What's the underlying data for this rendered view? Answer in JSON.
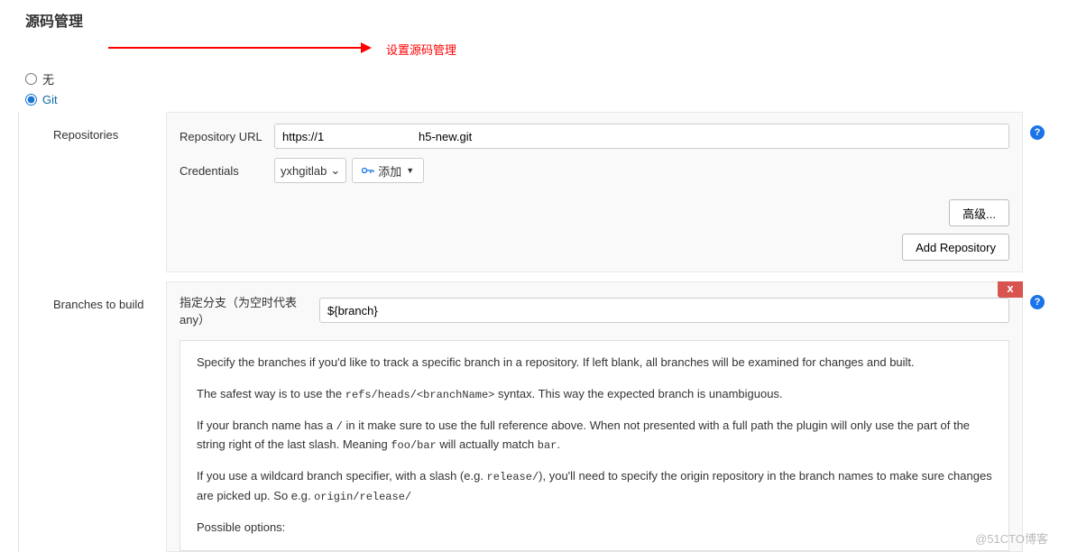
{
  "section_title": "源码管理",
  "annotation": "设置源码管理",
  "scm_options": {
    "none": "无",
    "git": "Git"
  },
  "repositories": {
    "label": "Repositories",
    "url_label": "Repository URL",
    "url_value": "https://1                             h5-new.git",
    "cred_label": "Credentials",
    "cred_value": "yxhgitlab",
    "add_label": "添加",
    "advanced_btn": "高级...",
    "add_repo_btn": "Add Repository"
  },
  "branches": {
    "label": "Branches to build",
    "field_label": "指定分支（为空时代表any）",
    "field_value": "${branch}"
  },
  "help": {
    "p1": "Specify the branches if you'd like to track a specific branch in a repository. If left blank, all branches will be examined for changes and built.",
    "p2a": "The safest way is to use the ",
    "p2code": "refs/heads/<branchName>",
    "p2b": " syntax. This way the expected branch is unambiguous.",
    "p3a": "If your branch name has a ",
    "p3code1": "/",
    "p3b": " in it make sure to use the full reference above. When not presented with a full path the plugin will only use the part of the string right of the last slash. Meaning ",
    "p3code2": "foo/bar",
    "p3c": " will actually match ",
    "p3code3": "bar",
    "p3d": ".",
    "p4a": "If you use a wildcard branch specifier, with a slash (e.g. ",
    "p4code1": "release/",
    "p4b": "), you'll need to specify the origin repository in the branch names to make sure changes are picked up. So e.g. ",
    "p4code2": "origin/release/",
    "p5": "Possible options:"
  },
  "watermark": "@51CTO博客"
}
